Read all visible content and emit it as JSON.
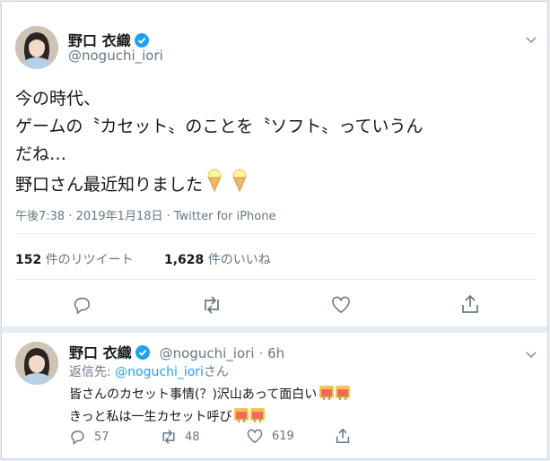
{
  "main_tweet": {
    "display_name": "野口 衣織",
    "handle": "@noguchi_iori",
    "text_lines": [
      "今の時代、",
      "ゲームの〝カセット〟のことを〝ソフト〟っていうん",
      "だね…",
      "野口さん最近知りました"
    ],
    "emoji_icons": [
      "ice-cream-icon",
      "ice-cream-icon"
    ],
    "timestamp": "午後7:38 · 2019年1月18日 · Twitter for iPhone",
    "retweets": {
      "count": "152",
      "label": "件のリツイート"
    },
    "likes": {
      "count": "1,628",
      "label": "件のいいね"
    }
  },
  "reply_tweet": {
    "display_name": "野口 衣織",
    "handle": "@noguchi_iori",
    "time": "6h",
    "reply_prefix": "返信先: ",
    "reply_to": "@noguchi_iori",
    "reply_suffix": "さん",
    "text_lines": [
      "皆さんのカセット事情(？)沢山あって面白い",
      "きっと私は一生カセット呼び"
    ],
    "replies": "57",
    "retweets": "48",
    "likes": "619"
  },
  "colors": {
    "accent": "#1da1f2",
    "verified": "#1da1f2",
    "muted": "#657786",
    "border": "#e6ecf0"
  }
}
